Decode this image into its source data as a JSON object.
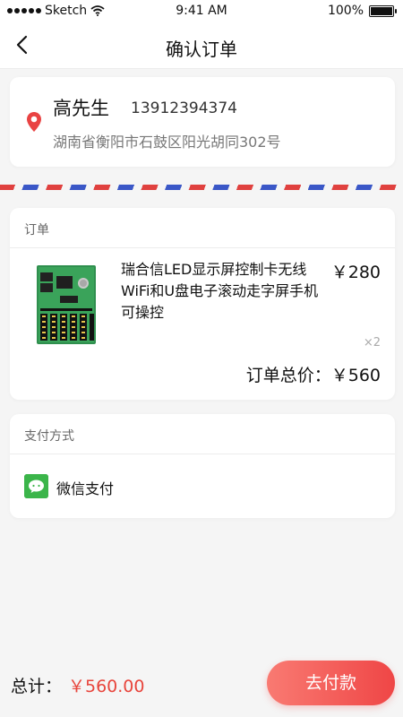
{
  "status_bar": {
    "carrier": "Sketch",
    "time": "9:41 AM",
    "battery": "100%"
  },
  "nav": {
    "title": "确认订单"
  },
  "address": {
    "name": "高先生",
    "phone": "13912394374",
    "detail": "湖南省衡阳市石鼓区阳光胡同302号"
  },
  "order": {
    "section_title": "订单",
    "product": {
      "name": "瑞合信LED显示屏控制卡无线WiFi和U盘电子滚动走字屏手机可操控",
      "price": "￥280",
      "quantity": "×2"
    },
    "total_label": "订单总价：",
    "total_value": "￥560"
  },
  "payment": {
    "section_title": "支付方式",
    "method": "微信支付",
    "method_icon": "wechat-icon"
  },
  "footer": {
    "total_label": "总计：",
    "total_amount": "￥560.00",
    "pay_button": "去付款"
  },
  "colors": {
    "accent_red": "#e8453c",
    "button_start": "#f97a72",
    "button_end": "#ef4646",
    "pin_red": "#e94343",
    "wechat_green": "#3bb54a",
    "airmail_red": "#e0413f",
    "airmail_blue": "#3a57c7"
  }
}
